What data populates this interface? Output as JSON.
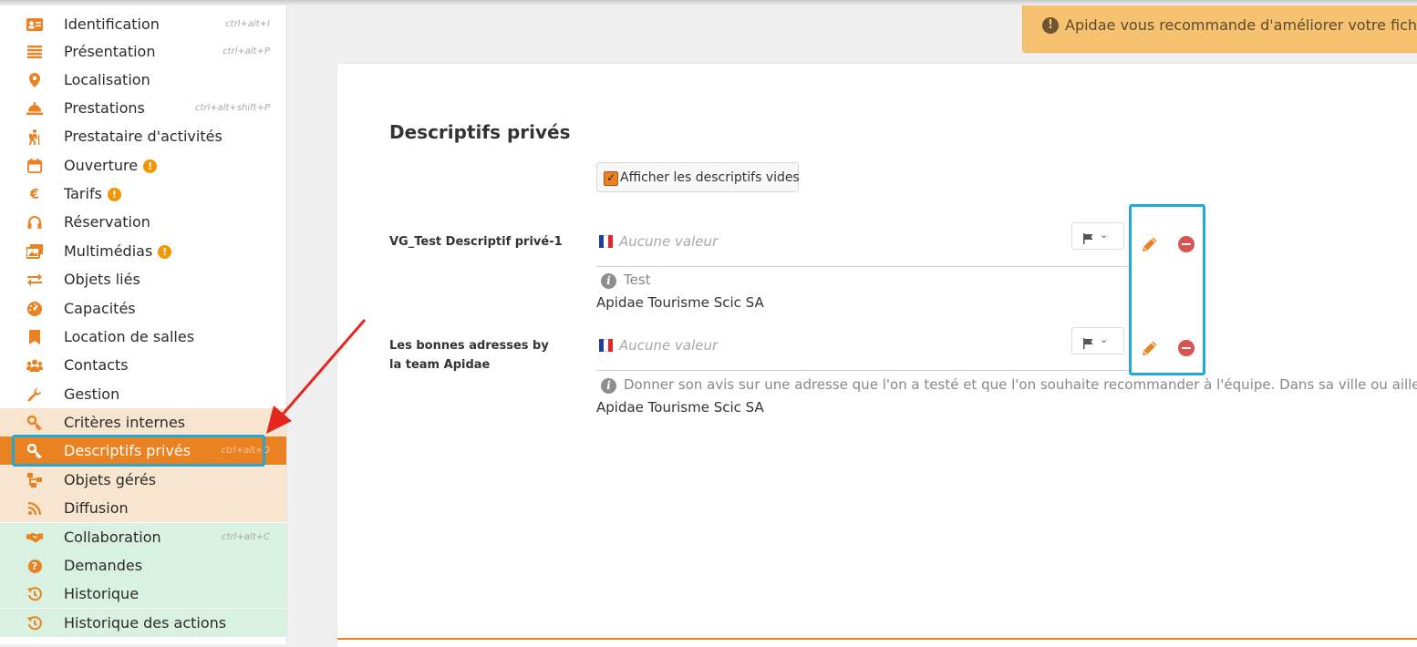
{
  "sidebar": {
    "items": [
      {
        "label": "Identification",
        "shortcut": "ctrl+alt+I",
        "icon": "id-card-icon"
      },
      {
        "label": "Présentation",
        "shortcut": "ctrl+alt+P",
        "icon": "lines-icon"
      },
      {
        "label": "Localisation",
        "shortcut": "",
        "icon": "map-pin-icon"
      },
      {
        "label": "Prestations",
        "shortcut": "ctrl+alt+shift+P",
        "icon": "service-bell-icon"
      },
      {
        "label": "Prestataire d'activités",
        "shortcut": "",
        "icon": "hiker-icon"
      },
      {
        "label": "Ouverture",
        "shortcut": "",
        "icon": "calendar-icon",
        "warning": "!"
      },
      {
        "label": "Tarifs",
        "shortcut": "",
        "icon": "euro-icon",
        "warning": "!"
      },
      {
        "label": "Réservation",
        "shortcut": "",
        "icon": "headset-icon"
      },
      {
        "label": "Multimédias",
        "shortcut": "",
        "icon": "images-icon",
        "warning": "!"
      },
      {
        "label": "Objets liés",
        "shortcut": "",
        "icon": "exchange-icon"
      },
      {
        "label": "Capacités",
        "shortcut": "",
        "icon": "gauge-icon"
      },
      {
        "label": "Location de salles",
        "shortcut": "",
        "icon": "bookmark-icon"
      },
      {
        "label": "Contacts",
        "shortcut": "",
        "icon": "users-icon"
      },
      {
        "label": "Gestion",
        "shortcut": "",
        "icon": "wrench-icon"
      },
      {
        "label": "Critères internes",
        "shortcut": "",
        "icon": "key-icon"
      },
      {
        "label": "Descriptifs privés",
        "shortcut": "ctrl+alt+D",
        "icon": "key-icon"
      },
      {
        "label": "Objets gérés",
        "shortcut": "",
        "icon": "sitemap-icon"
      },
      {
        "label": "Diffusion",
        "shortcut": "",
        "icon": "rss-icon"
      },
      {
        "label": "Collaboration",
        "shortcut": "ctrl+alt+C",
        "icon": "handshake-icon"
      },
      {
        "label": "Demandes",
        "shortcut": "",
        "icon": "question-circle-icon"
      },
      {
        "label": "Historique",
        "shortcut": "",
        "icon": "history-icon"
      },
      {
        "label": "Historique des actions",
        "shortcut": "",
        "icon": "history-icon"
      }
    ],
    "active_index": 15
  },
  "alert": {
    "icon": "!",
    "text": "Apidae vous recommande d'améliorer votre fiche"
  },
  "main": {
    "title": "Descriptifs privés",
    "show_empty_label": "Afficher les descriptifs vides",
    "show_empty_checked": true,
    "fields": [
      {
        "label": "VG_Test Descriptif privé-1",
        "placeholder": "Aucune valeur",
        "info": "Test",
        "owner": "Apidae Tourisme Scic SA"
      },
      {
        "label": "Les bonnes adresses by la team Apidae",
        "placeholder": "Aucune valeur",
        "info": "Donner son avis sur une adresse que l'on a testé et que l'on souhaite recommander à l'équipe. Dans sa ville ou ailleurs.",
        "owner": "Apidae Tourisme Scic SA"
      }
    ]
  },
  "colors": {
    "accent": "#ea8222",
    "highlight": "#20a8d9",
    "alert_bg": "#f7c26f",
    "remove": "#d9534f"
  }
}
